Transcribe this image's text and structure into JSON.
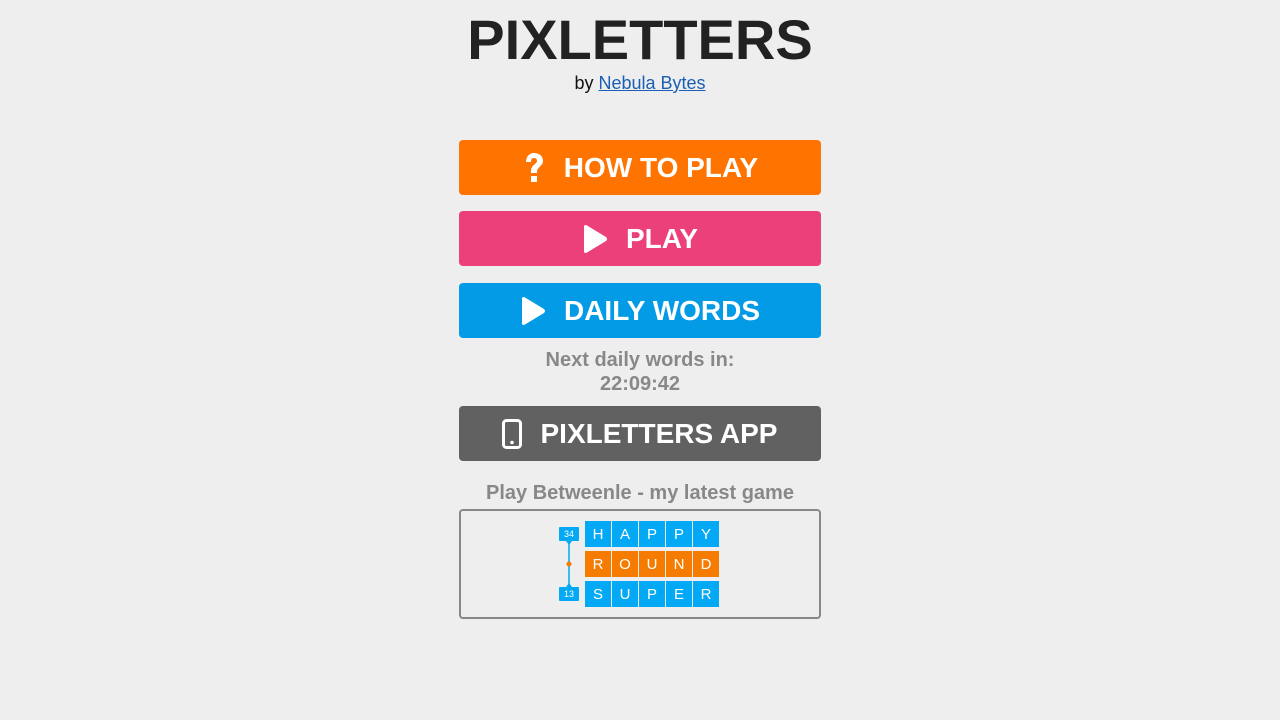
{
  "header": {
    "title": "PIXLETTERS",
    "by_prefix": "by",
    "author_link": "Nebula Bytes"
  },
  "buttons": {
    "how_to_play": "HOW TO PLAY",
    "play": "PLAY",
    "daily_words": "DAILY WORDS",
    "app": "PIXLETTERS APP"
  },
  "daily": {
    "next_label": "Next daily words in:",
    "timer": "22:09:42"
  },
  "promo": {
    "label": "Play Betweenle - my latest game",
    "logo": {
      "count_top": "34",
      "count_bottom": "13",
      "row1": [
        "H",
        "A",
        "P",
        "P",
        "Y"
      ],
      "row2": [
        "R",
        "O",
        "U",
        "N",
        "D"
      ],
      "row3": [
        "S",
        "U",
        "P",
        "E",
        "R"
      ]
    }
  },
  "icons": {
    "how_to_play": "question-icon",
    "play": "play-icon",
    "daily_words": "play-icon",
    "app": "phone-icon"
  },
  "colors": {
    "background": "#eeeeee",
    "how_to_play": "#ff7300",
    "play": "#ec407a",
    "daily_words": "#039be5",
    "app": "#616161",
    "muted_text": "#888888",
    "tile_blue": "#03a9f4",
    "tile_orange": "#f57c00"
  }
}
